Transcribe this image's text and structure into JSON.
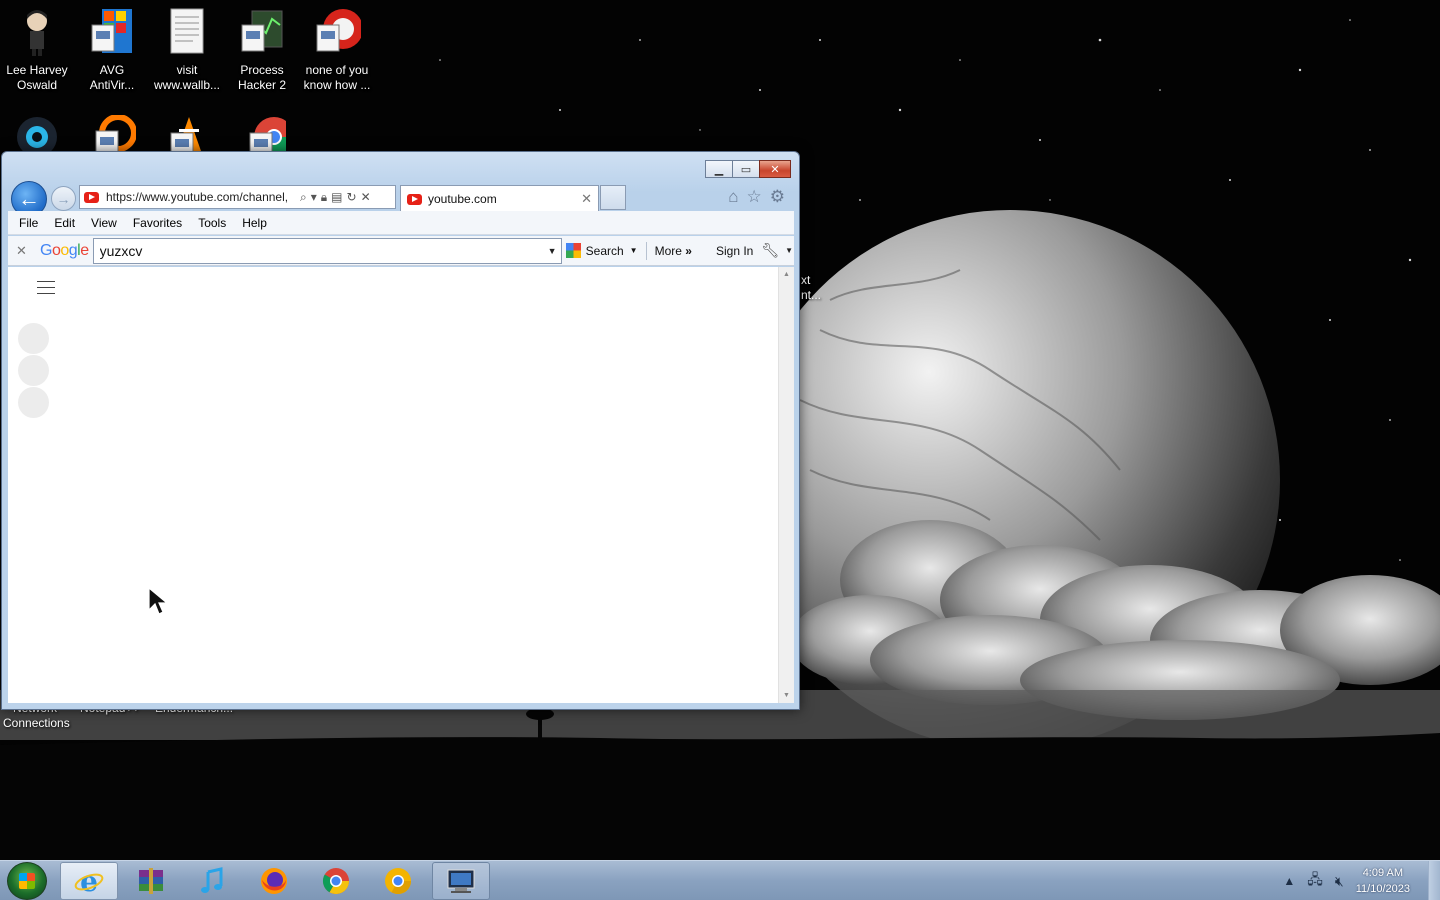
{
  "desktop": {
    "icons_row1": [
      {
        "label": "Lee Harvey\nOswald",
        "icon": "character-icon"
      },
      {
        "label": "AVG\nAntiVir...",
        "icon": "avg-antivirus-icon"
      },
      {
        "label": "visit\nwww.wallb...",
        "icon": "text-document-icon"
      },
      {
        "label": "Process\nHacker 2",
        "icon": "process-hacker-icon"
      },
      {
        "label": "none of you\nknow how ...",
        "icon": "shortcut-icon"
      }
    ],
    "partial_labels": {
      "network_connections_line1": "Network",
      "network_connections_line2": "Connections",
      "notepad": "Notepad++",
      "endermanch": "Endermanch...",
      "right_edge_1": "xt",
      "right_edge_2": "nt..."
    }
  },
  "browser": {
    "address_url": "https://www.youtube.com/channel,",
    "tab_title": "youtube.com",
    "menu": [
      "File",
      "Edit",
      "View",
      "Favorites",
      "Tools",
      "Help"
    ],
    "google_toolbar": {
      "logo": "Google",
      "query": "yuzxcv",
      "search_label": "Search",
      "more_label": "More",
      "signin_label": "Sign In"
    }
  },
  "taskbar": {
    "time": "4:09 AM",
    "date": "11/10/2023",
    "apps": [
      "internet-explorer-icon",
      "winrar-icon",
      "itunes-icon",
      "firefox-icon",
      "chrome-icon",
      "chrome-canary-icon",
      "remote-desktop-icon"
    ]
  },
  "colors": {
    "accent_blue": "#1f6bc8",
    "close_red": "#c8452d",
    "youtube_red": "#e62117"
  }
}
